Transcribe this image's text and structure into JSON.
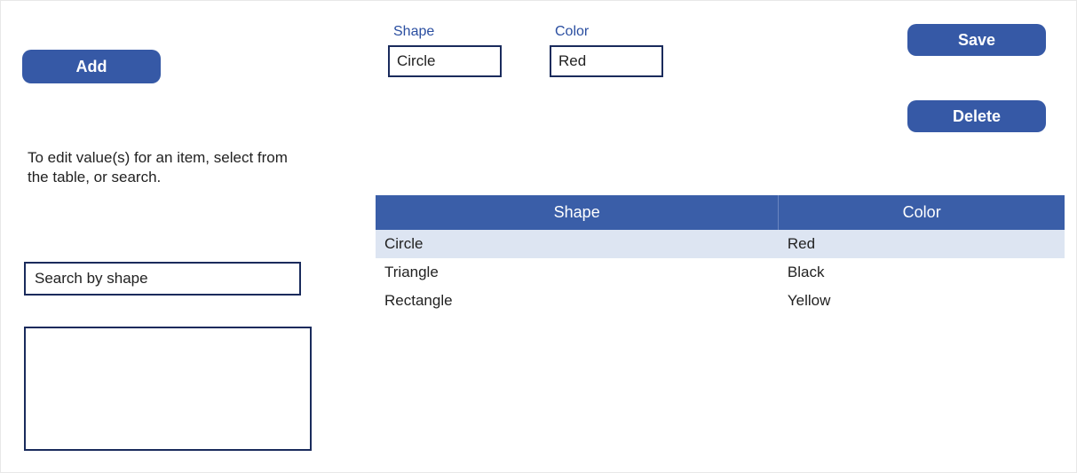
{
  "buttons": {
    "add": "Add",
    "save": "Save",
    "delete": "Delete"
  },
  "fields": {
    "shape": {
      "label": "Shape",
      "value": "Circle"
    },
    "color": {
      "label": "Color",
      "value": "Red"
    }
  },
  "help_text": "To edit value(s) for an item, select from the table, or search.",
  "search": {
    "placeholder": "Search by shape",
    "value": ""
  },
  "table": {
    "headers": {
      "shape": "Shape",
      "color": "Color"
    },
    "rows": [
      {
        "shape": "Circle",
        "color": "Red",
        "selected": true
      },
      {
        "shape": "Triangle",
        "color": "Black",
        "selected": false
      },
      {
        "shape": "Rectangle",
        "color": "Yellow",
        "selected": false
      }
    ]
  }
}
